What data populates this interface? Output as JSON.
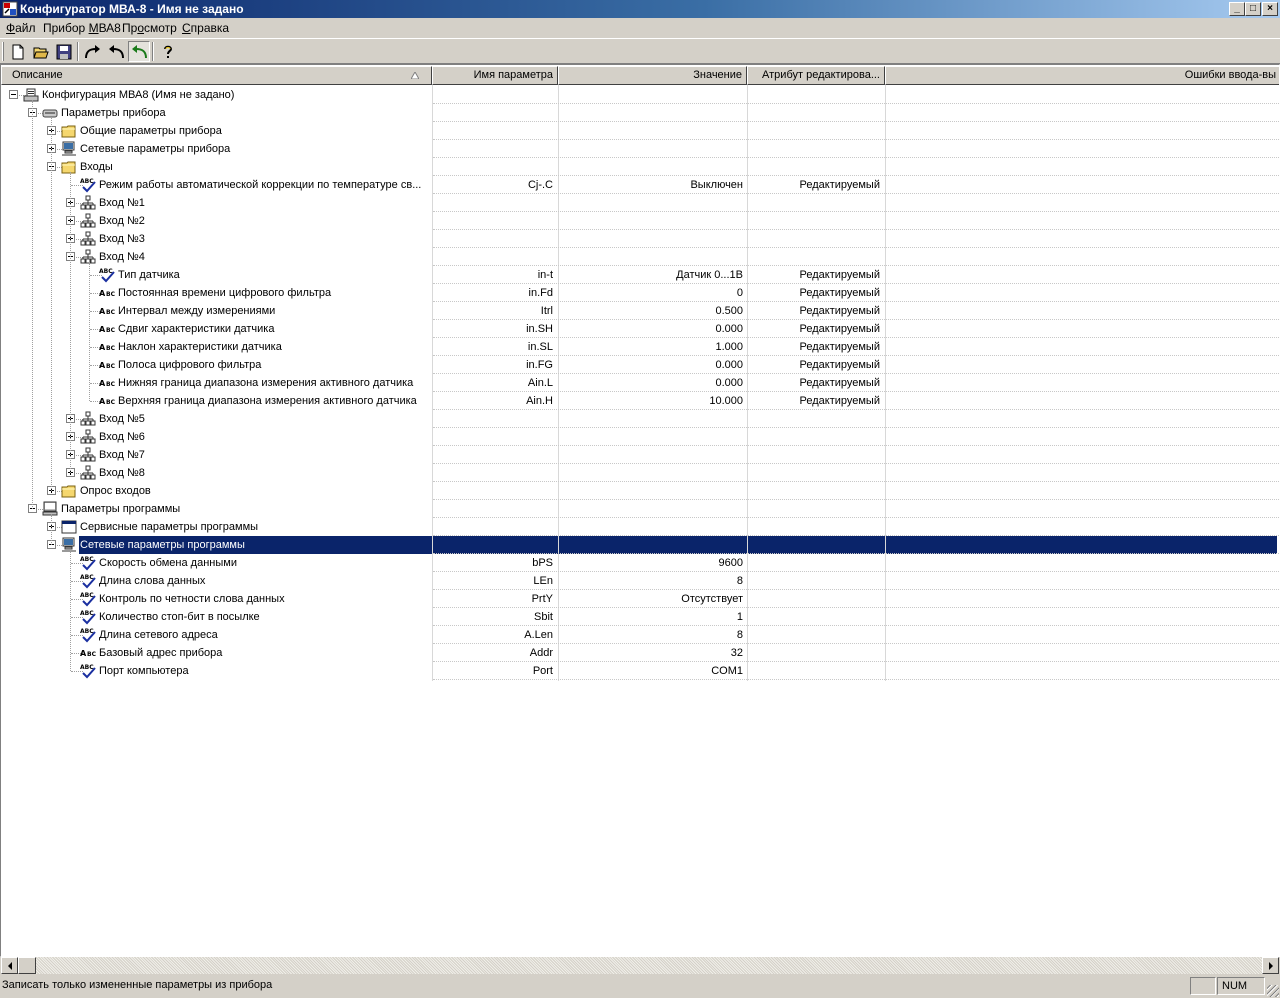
{
  "window": {
    "title": "Конфигуратор МВА-8 - Имя не задано",
    "buttons": [
      "_",
      "□",
      "×"
    ]
  },
  "menu": [
    {
      "pre": "",
      "key": "Ф",
      "post": "айл"
    },
    {
      "pre": "Прибор ",
      "key": "М",
      "post": "ВА8"
    },
    {
      "pre": "Пр",
      "key": "о",
      "post": "смотр"
    },
    {
      "pre": "",
      "key": "С",
      "post": "правка"
    }
  ],
  "toolbar": {
    "items": [
      "new-icon",
      "open-icon",
      "save-icon",
      "separator",
      "redo-icon",
      "undo-icon",
      "undo-green-icon",
      "separator",
      "help-icon"
    ]
  },
  "columns": {
    "description": "Описание",
    "param_name": "Имя параметра",
    "value": "Значение",
    "attribute": "Атрибут редактирова...",
    "errors": "Ошибки ввода-вы"
  },
  "tree": [
    {
      "level": 0,
      "exp": "minus",
      "icon": "device-config-icon",
      "label": "Конфигурация МВА8 (Имя не задано)"
    },
    {
      "level": 1,
      "exp": "minus",
      "icon": "device-icon",
      "label": "Параметры прибора"
    },
    {
      "level": 2,
      "exp": "plus",
      "icon": "folder-icon",
      "label": "Общие параметры прибора"
    },
    {
      "level": 2,
      "exp": "plus",
      "icon": "network-computer-icon",
      "label": "Сетевые параметры прибора"
    },
    {
      "level": 2,
      "exp": "minus",
      "icon": "folder-icon",
      "label": "Входы"
    },
    {
      "level": 3,
      "exp": "none",
      "icon": "abc-check-icon",
      "label": "Режим работы автоматической коррекции по температуре св...",
      "name": "Cj-.C",
      "value": "Выключен",
      "attr": "Редактируемый"
    },
    {
      "level": 3,
      "exp": "plus",
      "icon": "network-tree-icon",
      "label": "Вход №1"
    },
    {
      "level": 3,
      "exp": "plus",
      "icon": "network-tree-icon",
      "label": "Вход №2"
    },
    {
      "level": 3,
      "exp": "plus",
      "icon": "network-tree-icon",
      "label": "Вход №3"
    },
    {
      "level": 3,
      "exp": "minus",
      "icon": "network-tree-icon",
      "label": "Вход №4"
    },
    {
      "level": 4,
      "exp": "none",
      "icon": "abc-check-icon",
      "label": "Тип датчика",
      "name": "in-t",
      "value": "Датчик 0...1В",
      "attr": "Редактируемый"
    },
    {
      "level": 4,
      "exp": "none",
      "icon": "abc-text-icon",
      "label": "Постоянная времени  цифрового фильтра",
      "name": "in.Fd",
      "value": "0",
      "attr": "Редактируемый"
    },
    {
      "level": 4,
      "exp": "none",
      "icon": "abc-text-icon",
      "label": "Интервал между измерениями",
      "name": "Itrl",
      "value": "0.500",
      "attr": "Редактируемый"
    },
    {
      "level": 4,
      "exp": "none",
      "icon": "abc-text-icon",
      "label": "Сдвиг характеристики датчика",
      "name": "in.SH",
      "value": "0.000",
      "attr": "Редактируемый"
    },
    {
      "level": 4,
      "exp": "none",
      "icon": "abc-text-icon",
      "label": "Наклон характеристики датчика",
      "name": "in.SL",
      "value": "1.000",
      "attr": "Редактируемый"
    },
    {
      "level": 4,
      "exp": "none",
      "icon": "abc-text-icon",
      "label": "Полоса цифрового фильтра",
      "name": "in.FG",
      "value": "0.000",
      "attr": "Редактируемый"
    },
    {
      "level": 4,
      "exp": "none",
      "icon": "abc-text-icon",
      "label": "Нижняя граница диапазона измерения активного датчика",
      "name": "Ain.L",
      "value": "0.000",
      "attr": "Редактируемый"
    },
    {
      "level": 4,
      "exp": "none",
      "icon": "abc-text-icon",
      "label": "Верхняя граница диапазона измерения активного датчика",
      "name": "Ain.H",
      "value": "10.000",
      "attr": "Редактируемый"
    },
    {
      "level": 3,
      "exp": "plus",
      "icon": "network-tree-icon",
      "label": "Вход №5"
    },
    {
      "level": 3,
      "exp": "plus",
      "icon": "network-tree-icon",
      "label": "Вход №6"
    },
    {
      "level": 3,
      "exp": "plus",
      "icon": "network-tree-icon",
      "label": "Вход №7"
    },
    {
      "level": 3,
      "exp": "plus",
      "icon": "network-tree-icon",
      "label": "Вход №8"
    },
    {
      "level": 2,
      "exp": "plus",
      "icon": "folder-icon",
      "label": "Опрос входов"
    },
    {
      "level": 1,
      "exp": "minus",
      "icon": "computer-icon",
      "label": "Параметры программы"
    },
    {
      "level": 2,
      "exp": "plus",
      "icon": "window-icon",
      "label": "Сервисные параметры программы"
    },
    {
      "level": 2,
      "exp": "minus",
      "icon": "network-computer-icon",
      "label": "Сетевые параметры программы",
      "selected": true
    },
    {
      "level": 3,
      "exp": "none",
      "icon": "abc-check-icon",
      "label": "Скорость обмена данными",
      "name": "bPS",
      "value": "9600",
      "attr": ""
    },
    {
      "level": 3,
      "exp": "none",
      "icon": "abc-check-icon",
      "label": "Длина слова данных",
      "name": "LEn",
      "value": "8",
      "attr": ""
    },
    {
      "level": 3,
      "exp": "none",
      "icon": "abc-check-icon",
      "label": "Контроль по четности слова данных",
      "name": "PrtY",
      "value": "Отсутствует",
      "attr": ""
    },
    {
      "level": 3,
      "exp": "none",
      "icon": "abc-check-icon",
      "label": "Количество стоп-бит в посылке",
      "name": "Sbit",
      "value": "1",
      "attr": ""
    },
    {
      "level": 3,
      "exp": "none",
      "icon": "abc-check-icon",
      "label": "Длина сетевого адреса",
      "name": "A.Len",
      "value": "8",
      "attr": ""
    },
    {
      "level": 3,
      "exp": "none",
      "icon": "abc-text-icon",
      "label": "Базовый адрес прибора",
      "name": "Addr",
      "value": "32",
      "attr": ""
    },
    {
      "level": 3,
      "exp": "none",
      "icon": "abc-check-icon",
      "label": "Порт компьютера",
      "name": "Port",
      "value": "COM1",
      "attr": ""
    }
  ],
  "status": {
    "text": "Записать только измененные параметры из прибора",
    "num": "NUM"
  },
  "colors": {
    "selection": "#0a246a",
    "title_start": "#0a246a",
    "title_end": "#a6caf0",
    "folder": "#f5d76e",
    "check": "#1a2fa0"
  }
}
